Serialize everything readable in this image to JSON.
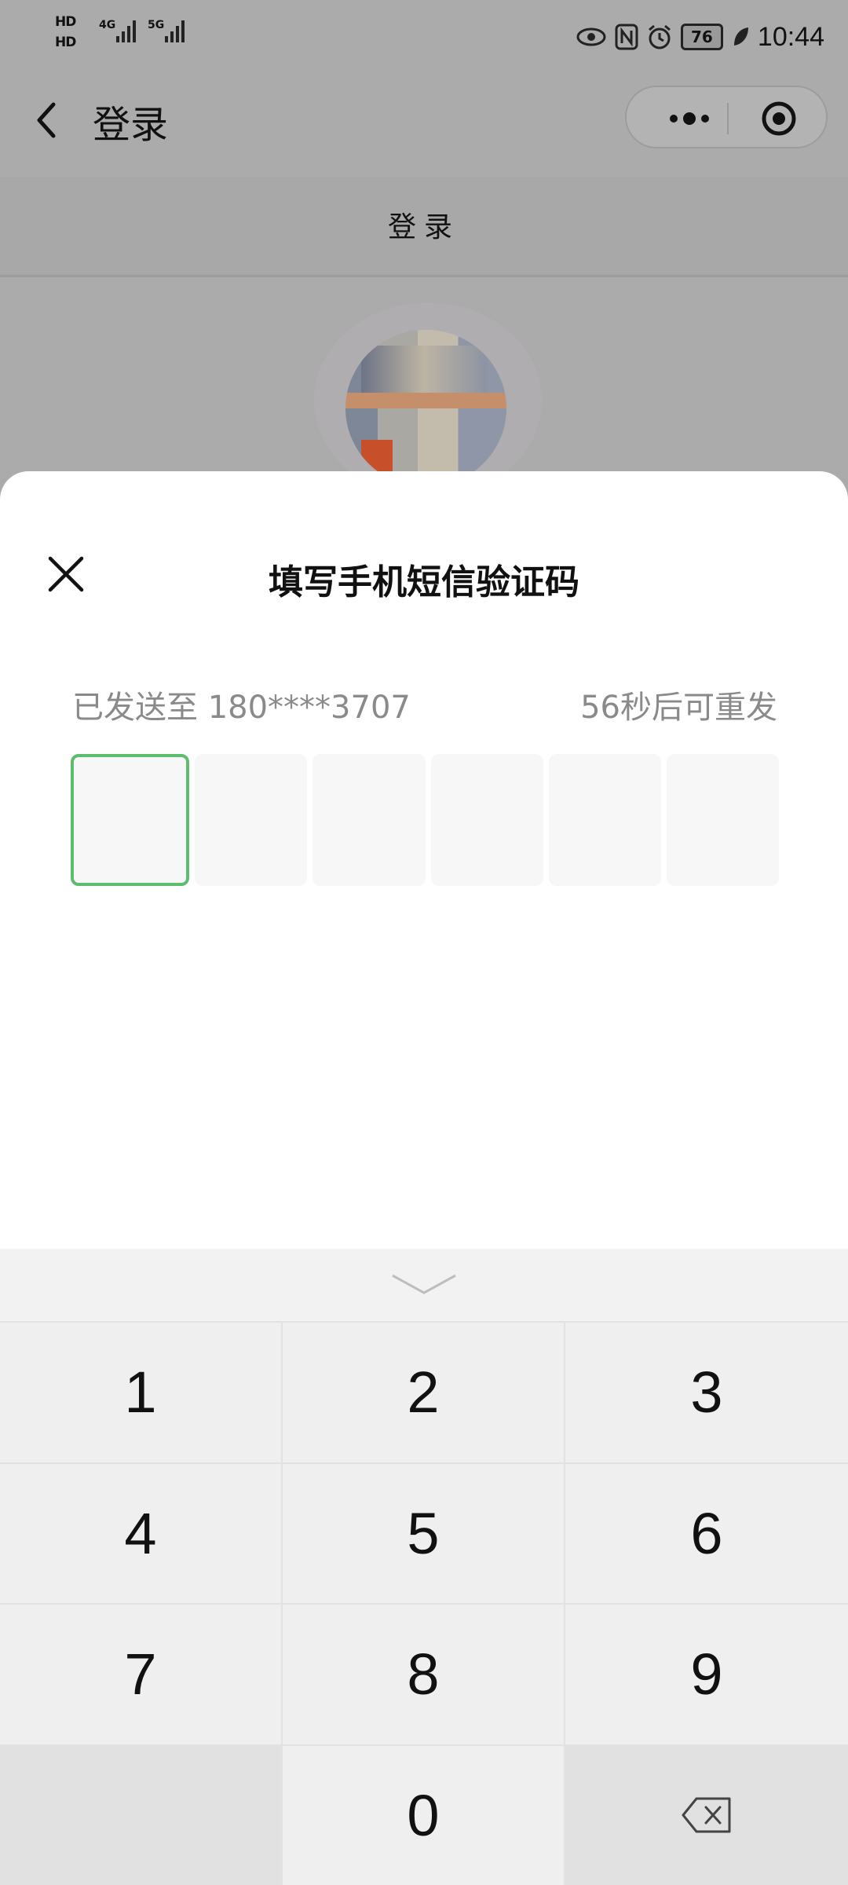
{
  "status_bar": {
    "hd1": "HD",
    "hd2": "HD",
    "net1": "4G",
    "net2": "5G",
    "battery": "76",
    "time": "10:44"
  },
  "nav": {
    "title": "登录"
  },
  "subheader": {
    "title": "登录"
  },
  "sheet": {
    "title": "填写手机短信验证码",
    "sent_to": "已发送至 180****3707",
    "resend": "56秒后可重发",
    "code_boxes": 6,
    "active_index": 0
  },
  "keypad": {
    "keys": [
      "1",
      "2",
      "3",
      "4",
      "5",
      "6",
      "7",
      "8",
      "9",
      "",
      "0",
      "⌫"
    ]
  },
  "colors": {
    "accent_green": "#5cbd6e",
    "overlay_gray": "#ababab"
  }
}
